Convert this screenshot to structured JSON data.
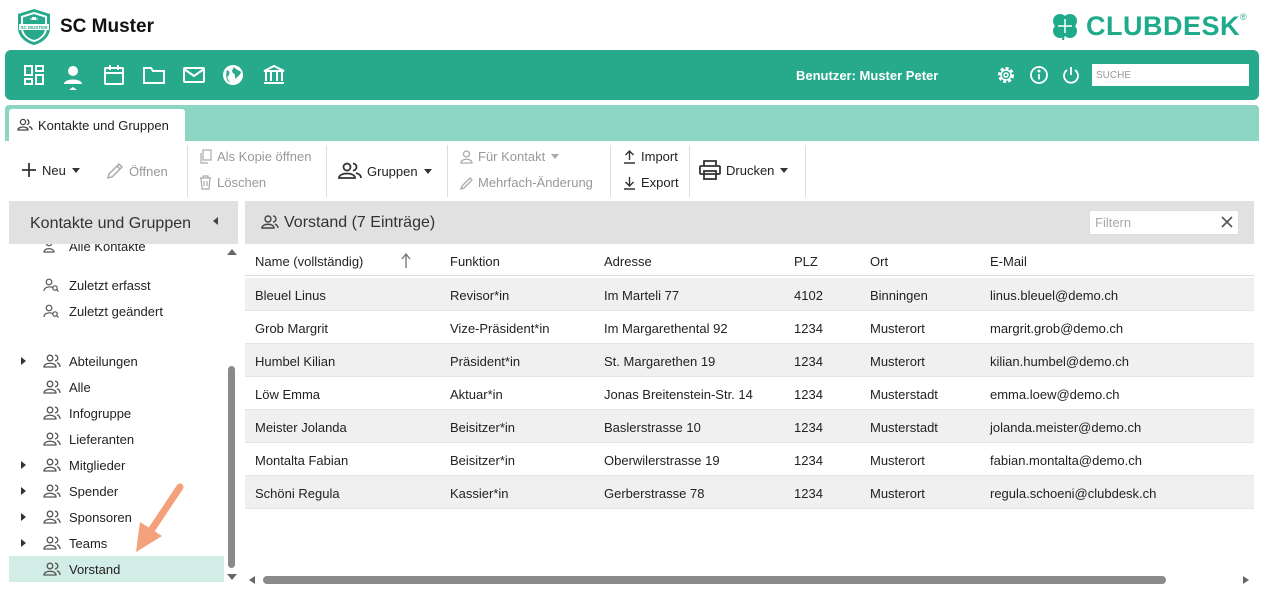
{
  "header": {
    "club_name": "SC Muster",
    "badge_text": "SC MUSTER",
    "brand_name": "CLUBDESK",
    "brand_reg": "®"
  },
  "topnav": {
    "icons": [
      "dashboard-icon",
      "contacts-icon",
      "calendar-icon",
      "folder-icon",
      "mail-icon",
      "globe-icon",
      "bank-icon"
    ],
    "user_text": "Benutzer: Muster Peter",
    "search_placeholder": "SUCHE"
  },
  "tabs": [
    {
      "label": "Kontakte und Gruppen"
    }
  ],
  "toolbar": {
    "new_label": "Neu",
    "open_label": "Öffnen",
    "copy_open_label": "Als Kopie öffnen",
    "delete_label": "Löschen",
    "groups_label": "Gruppen",
    "for_contact_label": "Für Kontakt",
    "multi_edit_label": "Mehrfach-Änderung",
    "import_label": "Import",
    "export_label": "Export",
    "print_label": "Drucken"
  },
  "sidebar": {
    "title": "Kontakte und Gruppen",
    "items": [
      {
        "label": "Alle Kontakte",
        "expandable": false
      },
      {
        "label": "Zuletzt erfasst",
        "expandable": false
      },
      {
        "label": "Zuletzt geändert",
        "expandable": false
      },
      {
        "label": "Abteilungen",
        "expandable": true
      },
      {
        "label": "Alle",
        "expandable": false
      },
      {
        "label": "Infogruppe",
        "expandable": false
      },
      {
        "label": "Lieferanten",
        "expandable": false
      },
      {
        "label": "Mitglieder",
        "expandable": true
      },
      {
        "label": "Spender",
        "expandable": true
      },
      {
        "label": "Sponsoren",
        "expandable": true
      },
      {
        "label": "Teams",
        "expandable": true
      },
      {
        "label": "Vorstand",
        "expandable": false,
        "selected": true
      }
    ]
  },
  "main": {
    "title": "Vorstand (7 Einträge)",
    "filter_placeholder": "Filtern",
    "columns": [
      "Name (vollständig)",
      "Funktion",
      "Adresse",
      "PLZ",
      "Ort",
      "E-Mail"
    ],
    "rows": [
      [
        "Bleuel Linus",
        "Revisor*in",
        "Im Marteli 77",
        "4102",
        "Binningen",
        "linus.bleuel@demo.ch"
      ],
      [
        "Grob Margrit",
        "Vize-Präsident*in",
        "Im Margarethental 92",
        "1234",
        "Musterort",
        "margrit.grob@demo.ch"
      ],
      [
        "Humbel Kilian",
        "Präsident*in",
        "St. Margarethen 19",
        "1234",
        "Musterort",
        "kilian.humbel@demo.ch"
      ],
      [
        "Löw Emma",
        "Aktuar*in",
        "Jonas Breitenstein-Str. 14",
        "1234",
        "Musterstadt",
        "emma.loew@demo.ch"
      ],
      [
        "Meister Jolanda",
        "Beisitzer*in",
        "Baslerstrasse 10",
        "1234",
        "Musterstadt",
        "jolanda.meister@demo.ch"
      ],
      [
        "Montalta Fabian",
        "Beisitzer*in",
        "Oberwilerstrasse 19",
        "1234",
        "Musterort",
        "fabian.montalta@demo.ch"
      ],
      [
        "Schöni Regula",
        "Kassier*in",
        "Gerberstrasse 78",
        "1234",
        "Musterort",
        "regula.schoeni@clubdesk.ch"
      ]
    ]
  },
  "colors": {
    "brand_green": "#27a98c",
    "tab_strip": "#8dd5c3",
    "selection": "#d2ece6",
    "annotation_arrow": "#f4a07a"
  }
}
